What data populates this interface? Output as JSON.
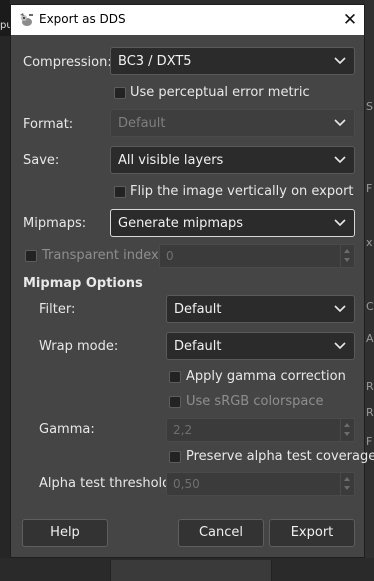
{
  "window": {
    "title": "Export as DDS",
    "close_glyph": "✕"
  },
  "background": {
    "left_text": "pu",
    "right_letters": [
      "S",
      "F",
      "x",
      "C",
      "A",
      "R",
      "R",
      "F"
    ]
  },
  "compression": {
    "label": "Compression:",
    "value": "BC3 / DXT5"
  },
  "perceptual": {
    "label": "Use perceptual error metric",
    "checked": false
  },
  "format": {
    "label": "Format:",
    "value": "Default",
    "enabled": false
  },
  "save": {
    "label": "Save:",
    "value": "All visible layers"
  },
  "flip": {
    "label": "Flip the image vertically on export",
    "checked": false
  },
  "mipmaps": {
    "label": "Mipmaps:",
    "value": "Generate mipmaps"
  },
  "transparent_index": {
    "label": "Transparent index:",
    "value": "0",
    "checked": false
  },
  "mipmap_options": {
    "heading": "Mipmap Options",
    "filter": {
      "label": "Filter:",
      "value": "Default"
    },
    "wrap_mode": {
      "label": "Wrap mode:",
      "value": "Default"
    },
    "gamma_correction": {
      "label": "Apply gamma correction",
      "checked": false
    },
    "srgb": {
      "label": "Use sRGB colorspace",
      "checked": false,
      "enabled": false
    },
    "gamma": {
      "label": "Gamma:",
      "value": "2,2"
    },
    "preserve_alpha": {
      "label": "Preserve alpha test coverage",
      "checked": false
    },
    "alpha_threshold": {
      "label": "Alpha test threshold:",
      "value": "0,50"
    }
  },
  "buttons": {
    "help": "Help",
    "cancel": "Cancel",
    "export": "Export"
  },
  "icons": {
    "title": "gimp-wilber-icon",
    "chevron": "chevron-down-icon"
  }
}
